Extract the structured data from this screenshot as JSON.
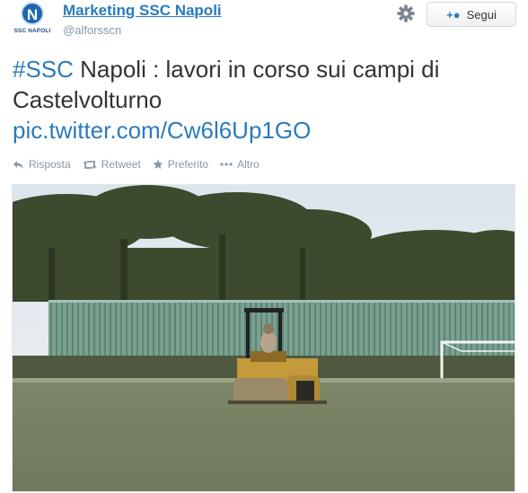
{
  "account": {
    "avatar_caption": "SSC NAPOLI",
    "avatar_letter": "N",
    "display_name": "Marketing SSC Napoli",
    "handle": "@alforsscn"
  },
  "follow_button": {
    "label": "Segui",
    "icon": "add-user-icon"
  },
  "settings_icon": "gear-icon",
  "tweet": {
    "hashtag": "#SSC",
    "text": " Napoli : lavori in corso sui campi di Castelvolturno",
    "link": "pic.twitter.com/Cw6l6Up1GO"
  },
  "actions": [
    {
      "label": "Risposta",
      "icon": "reply-icon"
    },
    {
      "label": "Retweet",
      "icon": "retweet-icon"
    },
    {
      "label": "Preferito",
      "icon": "star-icon"
    },
    {
      "label": "Altro",
      "icon": "more-icon"
    }
  ],
  "photo": {
    "description_icon": "tweet-photo",
    "colors": {
      "sky": "#dfe6ec",
      "trees": "#3e4a2f",
      "fence": "#6f9985",
      "grass": "#7d8669",
      "roller": "#c49a3a"
    }
  },
  "colors": {
    "link": "#2b7bb9",
    "muted": "#8899a6",
    "text": "#333333"
  }
}
